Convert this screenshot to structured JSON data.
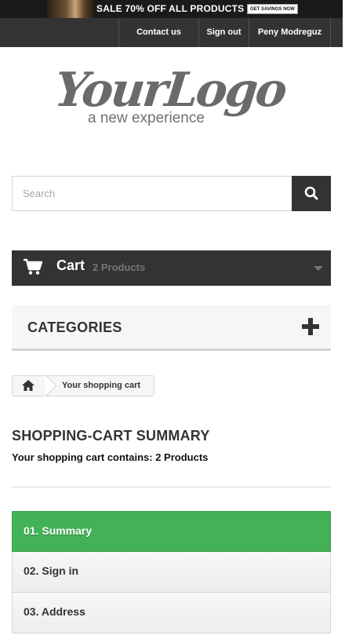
{
  "banner": {
    "text": "SALE 70% OFF ALL PRODUCTS",
    "cta": "GET SAVINGS NOW"
  },
  "nav": {
    "contact": "Contact us",
    "signout": "Sign out",
    "user": "Peny Modreguz"
  },
  "logo": {
    "main": "YourLogo",
    "tagline": "a new experience"
  },
  "search": {
    "placeholder": "Search",
    "value": ""
  },
  "cart": {
    "label": "Cart",
    "count": "2 Products"
  },
  "categories": {
    "title": "CATEGORIES"
  },
  "breadcrumb": {
    "current": "Your shopping cart"
  },
  "page": {
    "heading": "SHOPPING-CART SUMMARY",
    "summary": "Your shopping cart contains: 2 Products"
  },
  "steps": [
    {
      "label": "01. Summary",
      "active": true
    },
    {
      "label": "02. Sign in",
      "active": false
    },
    {
      "label": "03. Address",
      "active": false
    }
  ],
  "colors": {
    "dark": "#333333",
    "active_step": "#43b155",
    "border": "#d6d4d4"
  },
  "icons": {
    "search": "search-icon",
    "cart": "cart-icon",
    "home": "home-icon",
    "expand": "plus-icon",
    "dropdown": "caret-down-icon"
  }
}
